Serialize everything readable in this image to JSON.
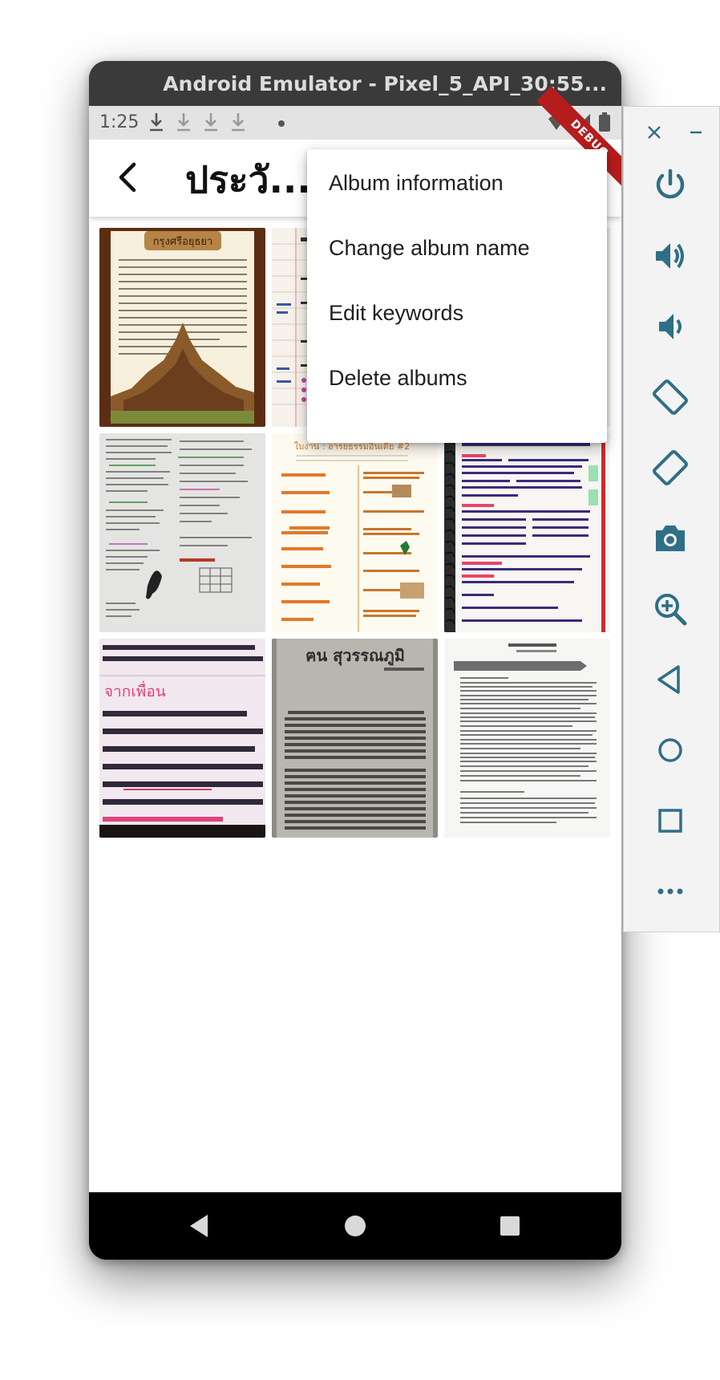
{
  "window": {
    "title": "Android Emulator - Pixel_5_API_30:55..."
  },
  "statusbar": {
    "time": "1:25",
    "debug_banner": "DEBUG"
  },
  "appbar": {
    "title": "ประวั..."
  },
  "menu": {
    "items": [
      {
        "label": "Album information"
      },
      {
        "label": "Change album name"
      },
      {
        "label": "Edit keywords"
      },
      {
        "label": "Delete albums"
      }
    ]
  },
  "thumbnails": [
    {
      "name": "ayutthaya-poster",
      "heading": "กรุงศรีอยุธยา"
    },
    {
      "name": "lined-notes"
    },
    {
      "name": "hidden-third"
    },
    {
      "name": "handwritten-notes"
    },
    {
      "name": "worksheet-orange",
      "heading": "ใบงาน : อารยธรรมอินเดีย #2"
    },
    {
      "name": "spiral-notebook"
    },
    {
      "name": "pink-text-photo",
      "heading": "จากเพื่อน"
    },
    {
      "name": "book-page",
      "heading": "ฅน สุวรรณภูมิ"
    },
    {
      "name": "printed-document"
    }
  ],
  "sidebar": {
    "buttons": [
      "power-icon",
      "volume-up-icon",
      "volume-down-icon",
      "rotate-left-icon",
      "rotate-right-icon",
      "camera-icon",
      "zoom-icon",
      "back-icon",
      "home-icon",
      "overview-icon",
      "more-icon"
    ]
  }
}
